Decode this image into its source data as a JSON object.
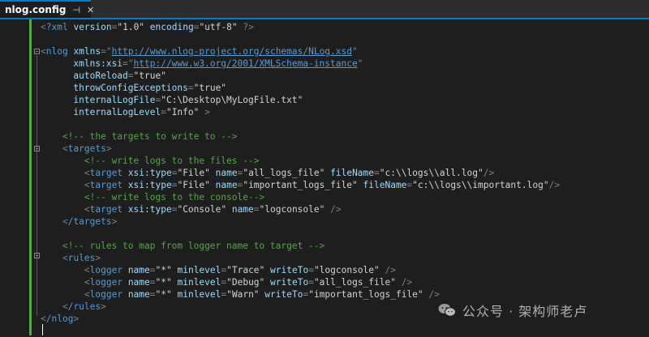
{
  "tab": {
    "title": "nlog.config",
    "pin_icon": "pin-icon",
    "close_icon": "close-icon"
  },
  "colors": {
    "tag": "#569cd6",
    "attr": "#9cdcfe",
    "comment": "#57a64a",
    "text": "#d4d4d4",
    "bracket": "#808080",
    "accent": "#007acc"
  },
  "code": {
    "l1_decl": "?xml",
    "l1_a1": "version",
    "l1_v1": "\"1.0\"",
    "l1_a2": "encoding",
    "l1_v2": "\"utf-8\"",
    "l1_end": "?>",
    "l3_tag": "nlog",
    "l3_attr": "xmlns",
    "l3_url": "http://www.nlog-project.org/schemas/NLog.xsd",
    "l4_attr": "xmlns:xsi",
    "l4_url": "http://www.w3.org/2001/XMLSchema-instance",
    "l5_attr": "autoReload",
    "l5_val": "\"true\"",
    "l6_attr": "throwConfigExceptions",
    "l6_val": "\"true\"",
    "l7_attr": "internalLogFile",
    "l7_val": "\"C:\\Desktop\\MyLogFile.txt\"",
    "l8_attr": "internalLogLevel",
    "l8_val": "\"Info\"",
    "l10_comment": "<!-- the targets to write to -->",
    "l11_tag": "targets",
    "l12_comment": "<!-- write logs to the files -->",
    "target_tag": "target",
    "xsi_type": "xsi:type",
    "name_attr": "name",
    "filename_attr": "fileName",
    "l13_type": "\"File\"",
    "l13_name": "\"all_logs_file\"",
    "l13_file": "\"c:\\\\logs\\\\all.log\"",
    "l14_type": "\"File\"",
    "l14_name": "\"important_logs_file\"",
    "l14_file": "\"c:\\\\logs\\\\important.log\"",
    "l15_comment": "<!-- write logs to the console-->",
    "l16_type": "\"Console\"",
    "l16_name": "\"logconsole\"",
    "l17_tag": "/targets",
    "l19_comment": "<!-- rules to map from logger name to target -->",
    "l20_tag": "rules",
    "logger_tag": "logger",
    "minlevel_attr": "minlevel",
    "writeto_attr": "writeTo",
    "star": "\"*\"",
    "l21_level": "\"Trace\"",
    "l21_to": "\"logconsole\"",
    "l22_level": "\"Debug\"",
    "l22_to": "\"all_logs_file\"",
    "l23_level": "\"Warn\"",
    "l23_to": "\"important_logs_file\"",
    "l24_tag": "/rules",
    "l25_tag": "/nlog"
  },
  "watermark": {
    "text": "公众号 · 架构师老卢",
    "icon": "wechat-icon"
  }
}
